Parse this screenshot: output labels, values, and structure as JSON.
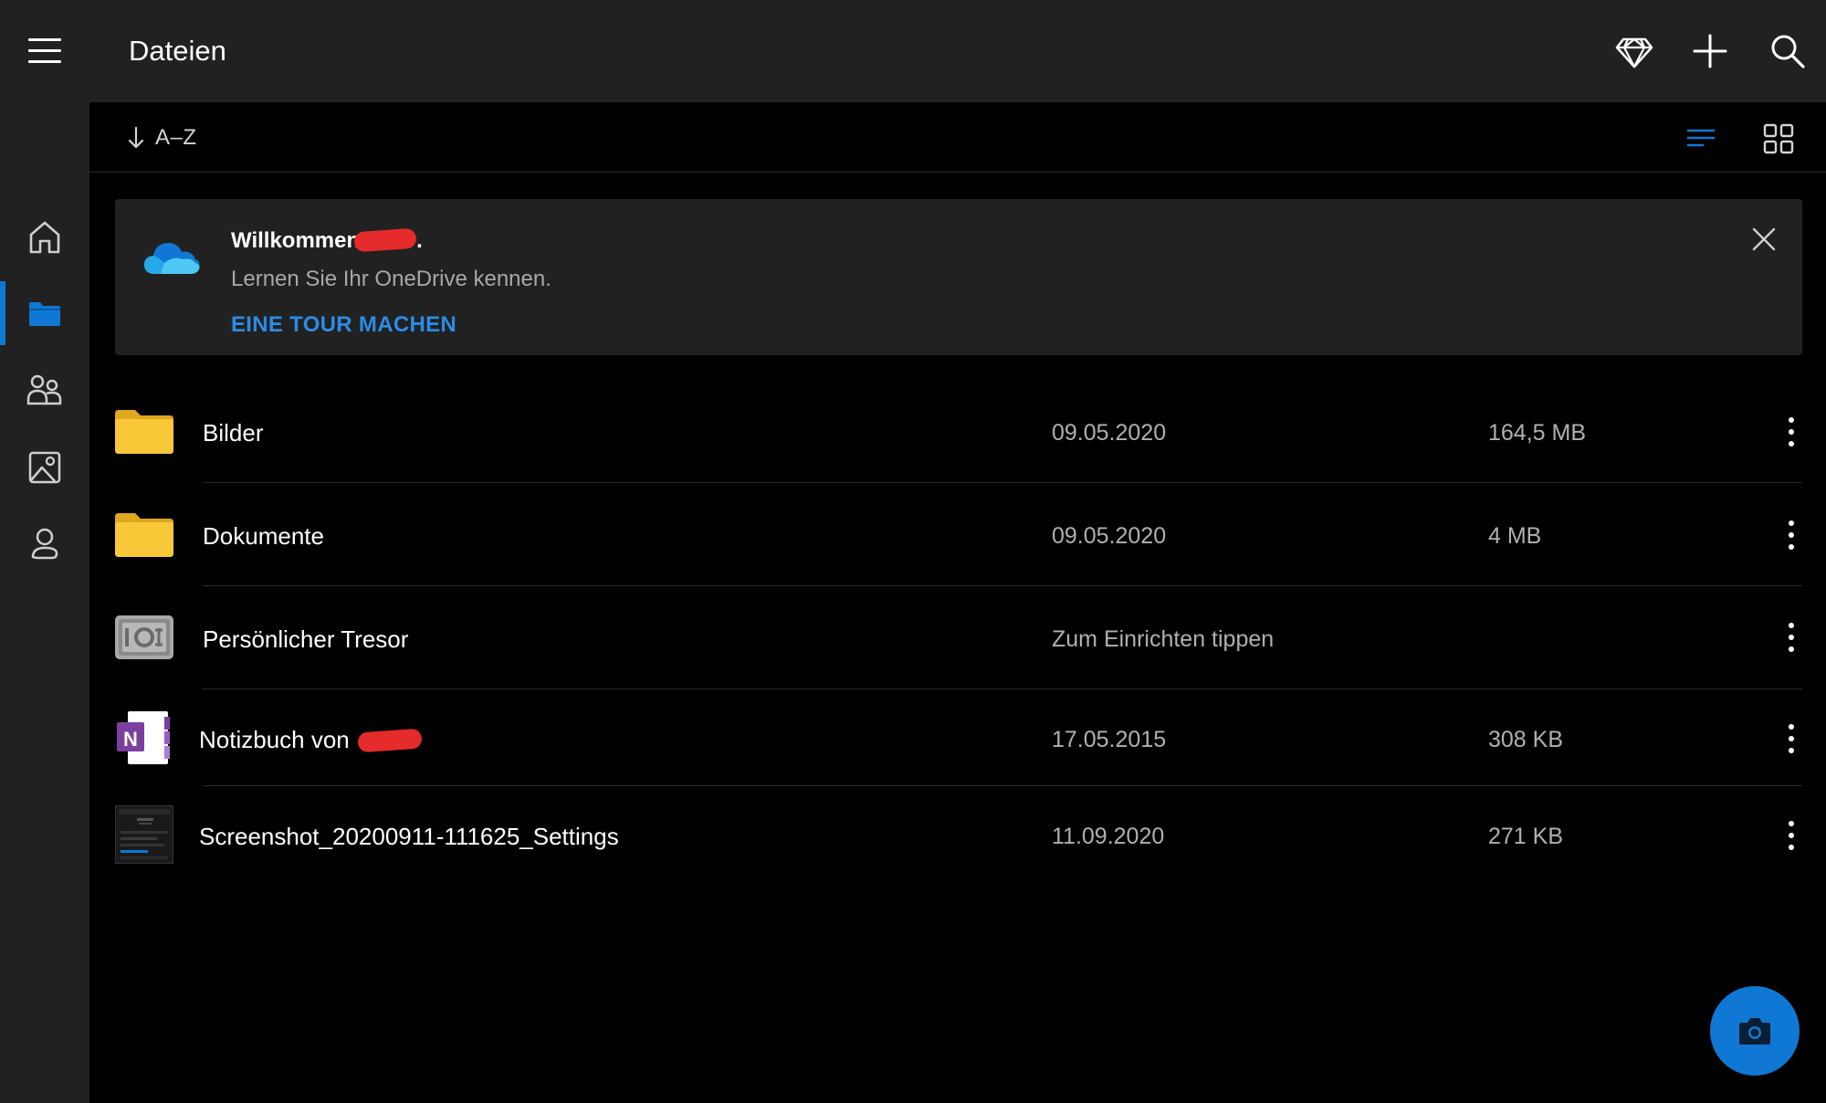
{
  "header": {
    "title": "Dateien",
    "icons": [
      "menu-icon",
      "diamond-icon",
      "plus-icon",
      "search-icon"
    ]
  },
  "sidebar": {
    "items": [
      {
        "icon": "home-icon",
        "active": false
      },
      {
        "icon": "folder-icon",
        "active": true
      },
      {
        "icon": "shared-people-icon",
        "active": false
      },
      {
        "icon": "photos-icon",
        "active": false
      },
      {
        "icon": "account-icon",
        "active": false
      }
    ]
  },
  "toolbar": {
    "sort_label": "A–Z",
    "sort_icon": "arrow-down-icon",
    "view_modes": [
      "list-view-icon",
      "grid-view-icon"
    ],
    "active_view": "list"
  },
  "banner": {
    "title": "Willkommen",
    "title_suffix": ".",
    "subtitle": "Lernen Sie Ihr OneDrive kennen.",
    "action": "EINE TOUR MACHEN",
    "icon": "onedrive-cloud-icon"
  },
  "files": [
    {
      "name": "Bilder",
      "date": "09.05.2020",
      "size": "164,5 MB",
      "icon": "folder-icon"
    },
    {
      "name": "Dokumente",
      "date": "09.05.2020",
      "size": "4 MB",
      "icon": "folder-icon"
    },
    {
      "name": "Persönlicher Tresor",
      "date": "Zum Einrichten tippen",
      "size": "",
      "icon": "vault-icon"
    },
    {
      "name": "Notizbuch von",
      "date": "17.05.2015",
      "size": "308 KB",
      "icon": "onenote-icon"
    },
    {
      "name": "Screenshot_20200911-111625_Settings",
      "date": "11.09.2020",
      "size": "271 KB",
      "icon": "image-thumbnail-icon"
    }
  ],
  "fab": {
    "icon": "camera-icon"
  },
  "colors": {
    "accent": "#0f78d4",
    "link": "#2b8ce6",
    "surface": "#212121",
    "background": "#000000",
    "folder": "#f8c838",
    "onenote": "#7b3fa0",
    "redaction": "#e52b2b"
  }
}
